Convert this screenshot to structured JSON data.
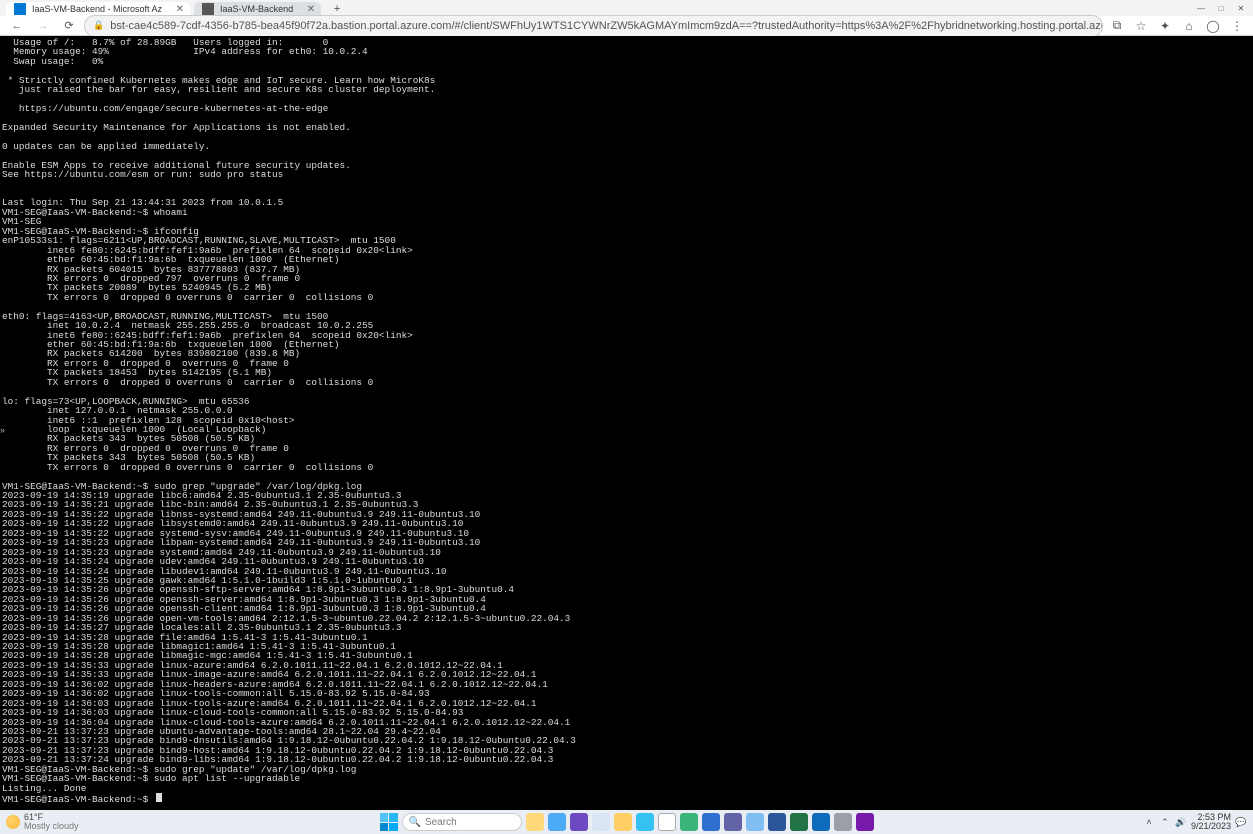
{
  "window": {
    "minimize": "—",
    "maximize": "□",
    "close": "✕"
  },
  "browser": {
    "tabs": [
      {
        "title": "IaaS-VM-Backend - Microsoft Az",
        "active": true
      },
      {
        "title": "IaaS-VM-Backend",
        "active": false
      }
    ],
    "newtab": "+",
    "nav": {
      "back": "←",
      "forward": "→",
      "reload": "⟳"
    },
    "url": "bst-cae4c589-7cdf-4356-b785-bea45f90f72a.bastion.portal.azure.com/#/client/SWFhUy1WTS1CYWNrZW5kAGMAYmImcm9zdA==?trustedAuthority=https%3A%2F%2Fhybridnetworking.hosting.portal.azure.net",
    "actions": {
      "fav_folder": "⧉",
      "star": "☆",
      "ext": "✦",
      "menu_ext": "⌂",
      "profile": "◯",
      "more": "⋮"
    }
  },
  "terminal": {
    "lines": [
      "  Usage of /:   8.7% of 28.89GB   Users logged in:       0",
      "  Memory usage: 49%               IPv4 address for eth0: 10.0.2.4",
      "  Swap usage:   0%",
      "",
      " * Strictly confined Kubernetes makes edge and IoT secure. Learn how MicroK8s",
      "   just raised the bar for easy, resilient and secure K8s cluster deployment.",
      "",
      "   https://ubuntu.com/engage/secure-kubernetes-at-the-edge",
      "",
      "Expanded Security Maintenance for Applications is not enabled.",
      "",
      "0 updates can be applied immediately.",
      "",
      "Enable ESM Apps to receive additional future security updates.",
      "See https://ubuntu.com/esm or run: sudo pro status",
      "",
      "",
      "Last login: Thu Sep 21 13:44:31 2023 from 10.0.1.5",
      "VM1-SEG@IaaS-VM-Backend:~$ whoami",
      "VM1-SEG",
      "VM1-SEG@IaaS-VM-Backend:~$ ifconfig",
      "enP10533s1: flags=6211<UP,BROADCAST,RUNNING,SLAVE,MULTICAST>  mtu 1500",
      "        inet6 fe80::6245:bdff:fef1:9a6b  prefixlen 64  scopeid 0x20<link>",
      "        ether 60:45:bd:f1:9a:6b  txqueuelen 1000  (Ethernet)",
      "        RX packets 604015  bytes 837778803 (837.7 MB)",
      "        RX errors 0  dropped 797  overruns 0  frame 0",
      "        TX packets 20089  bytes 5240945 (5.2 MB)",
      "        TX errors 0  dropped 0 overruns 0  carrier 0  collisions 0",
      "",
      "eth0: flags=4163<UP,BROADCAST,RUNNING,MULTICAST>  mtu 1500",
      "        inet 10.0.2.4  netmask 255.255.255.0  broadcast 10.0.2.255",
      "        inet6 fe80::6245:bdff:fef1:9a6b  prefixlen 64  scopeid 0x20<link>",
      "        ether 60:45:bd:f1:9a:6b  txqueuelen 1000  (Ethernet)",
      "        RX packets 614200  bytes 839802100 (839.8 MB)",
      "        RX errors 0  dropped 0  overruns 0  frame 0",
      "        TX packets 18453  bytes 5142195 (5.1 MB)",
      "        TX errors 0  dropped 0 overruns 0  carrier 0  collisions 0",
      "",
      "lo: flags=73<UP,LOOPBACK,RUNNING>  mtu 65536",
      "        inet 127.0.0.1  netmask 255.0.0.0",
      "        inet6 ::1  prefixlen 128  scopeid 0x10<host>",
      "        loop  txqueuelen 1000  (Local Loopback)",
      "        RX packets 343  bytes 50508 (50.5 KB)",
      "        RX errors 0  dropped 0  overruns 0  frame 0",
      "        TX packets 343  bytes 50508 (50.5 KB)",
      "        TX errors 0  dropped 0 overruns 0  carrier 0  collisions 0",
      "",
      "VM1-SEG@IaaS-VM-Backend:~$ sudo grep \"upgrade\" /var/log/dpkg.log",
      "2023-09-19 14:35:19 upgrade libc6:amd64 2.35-0ubuntu3.1 2.35-0ubuntu3.3",
      "2023-09-19 14:35:21 upgrade libc-bin:amd64 2.35-0ubuntu3.1 2.35-0ubuntu3.3",
      "2023-09-19 14:35:22 upgrade libnss-systemd:amd64 249.11-0ubuntu3.9 249.11-0ubuntu3.10",
      "2023-09-19 14:35:22 upgrade libsystemd0:amd64 249.11-0ubuntu3.9 249.11-0ubuntu3.10",
      "2023-09-19 14:35:22 upgrade systemd-sysv:amd64 249.11-0ubuntu3.9 249.11-0ubuntu3.10",
      "2023-09-19 14:35:23 upgrade libpam-systemd:amd64 249.11-0ubuntu3.9 249.11-0ubuntu3.10",
      "2023-09-19 14:35:23 upgrade systemd:amd64 249.11-0ubuntu3.9 249.11-0ubuntu3.10",
      "2023-09-19 14:35:24 upgrade udev:amd64 249.11-0ubuntu3.9 249.11-0ubuntu3.10",
      "2023-09-19 14:35:24 upgrade libudev1:amd64 249.11-0ubuntu3.9 249.11-0ubuntu3.10",
      "2023-09-19 14:35:25 upgrade gawk:amd64 1:5.1.0-1build3 1:5.1.0-1ubuntu0.1",
      "2023-09-19 14:35:26 upgrade openssh-sftp-server:amd64 1:8.9p1-3ubuntu0.3 1:8.9p1-3ubuntu0.4",
      "2023-09-19 14:35:26 upgrade openssh-server:amd64 1:8.9p1-3ubuntu0.3 1:8.9p1-3ubuntu0.4",
      "2023-09-19 14:35:26 upgrade openssh-client:amd64 1:8.9p1-3ubuntu0.3 1:8.9p1-3ubuntu0.4",
      "2023-09-19 14:35:26 upgrade open-vm-tools:amd64 2:12.1.5-3~ubuntu0.22.04.2 2:12.1.5-3~ubuntu0.22.04.3",
      "2023-09-19 14:35:27 upgrade locales:all 2.35-0ubuntu3.1 2.35-0ubuntu3.3",
      "2023-09-19 14:35:28 upgrade file:amd64 1:5.41-3 1:5.41-3ubuntu0.1",
      "2023-09-19 14:35:28 upgrade libmagic1:amd64 1:5.41-3 1:5.41-3ubuntu0.1",
      "2023-09-19 14:35:28 upgrade libmagic-mgc:amd64 1:5.41-3 1:5.41-3ubuntu0.1",
      "2023-09-19 14:35:33 upgrade linux-azure:amd64 6.2.0.1011.11~22.04.1 6.2.0.1012.12~22.04.1",
      "2023-09-19 14:35:33 upgrade linux-image-azure:amd64 6.2.0.1011.11~22.04.1 6.2.0.1012.12~22.04.1",
      "2023-09-19 14:36:02 upgrade linux-headers-azure:amd64 6.2.0.1011.11~22.04.1 6.2.0.1012.12~22.04.1",
      "2023-09-19 14:36:02 upgrade linux-tools-common:all 5.15.0-83.92 5.15.0-84.93",
      "2023-09-19 14:36:03 upgrade linux-tools-azure:amd64 6.2.0.1011.11~22.04.1 6.2.0.1012.12~22.04.1",
      "2023-09-19 14:36:03 upgrade linux-cloud-tools-common:all 5.15.0-83.92 5.15.0-84.93",
      "2023-09-19 14:36:04 upgrade linux-cloud-tools-azure:amd64 6.2.0.1011.11~22.04.1 6.2.0.1012.12~22.04.1",
      "2023-09-21 13:37:23 upgrade ubuntu-advantage-tools:amd64 28.1~22.04 29.4~22.04",
      "2023-09-21 13:37:23 upgrade bind9-dnsutils:amd64 1:9.18.12-0ubuntu0.22.04.2 1:9.18.12-0ubuntu0.22.04.3",
      "2023-09-21 13:37:23 upgrade bind9-host:amd64 1:9.18.12-0ubuntu0.22.04.2 1:9.18.12-0ubuntu0.22.04.3",
      "2023-09-21 13:37:24 upgrade bind9-libs:amd64 1:9.18.12-0ubuntu0.22.04.2 1:9.18.12-0ubuntu0.22.04.3",
      "VM1-SEG@IaaS-VM-Backend:~$ sudo grep \"update\" /var/log/dpkg.log",
      "VM1-SEG@IaaS-VM-Backend:~$ sudo apt list --upgradable",
      "Listing... Done"
    ],
    "prompt": "VM1-SEG@IaaS-VM-Backend:~$ ",
    "expand": "»"
  },
  "taskbar": {
    "weather": {
      "temp": "61°F",
      "desc": "Mostly cloudy"
    },
    "search_placeholder": "Search",
    "tray": {
      "chevron": "˄",
      "net": "⌃",
      "vol": "🔊",
      "time": "2:53 PM",
      "date": "9/21/2023",
      "notif": "💬"
    }
  }
}
